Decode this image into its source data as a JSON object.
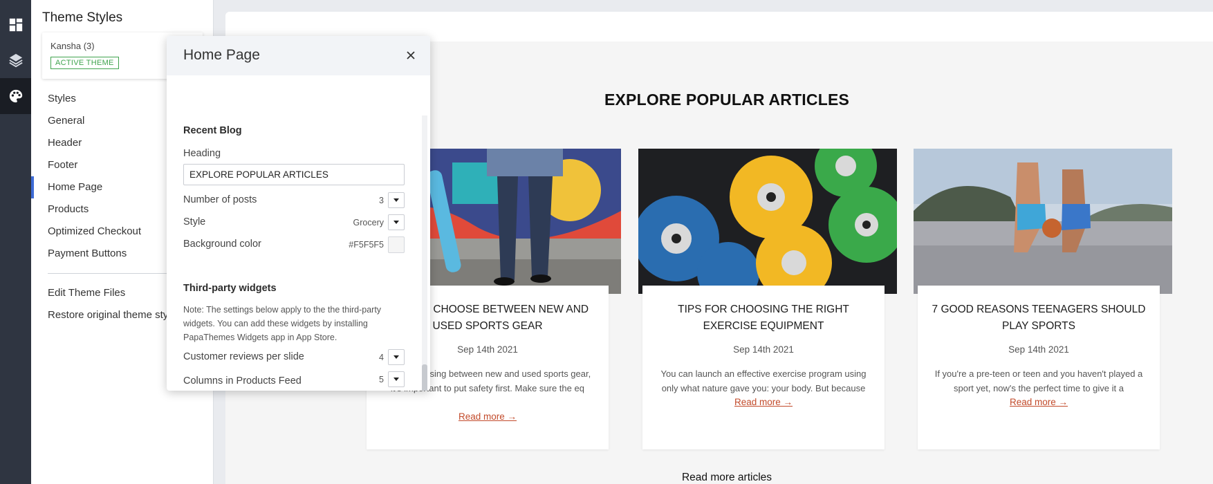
{
  "rail": {
    "items": [
      {
        "icon": "dashboard-icon"
      },
      {
        "icon": "layers-icon"
      },
      {
        "icon": "palette-icon",
        "active": true
      }
    ]
  },
  "sidebar": {
    "title": "Theme Styles",
    "theme": {
      "name": "Kansha (3)",
      "badge": "ACTIVE THEME"
    },
    "items": [
      {
        "label": "Styles"
      },
      {
        "label": "General"
      },
      {
        "label": "Header"
      },
      {
        "label": "Footer"
      },
      {
        "label": "Home Page",
        "active": true
      },
      {
        "label": "Products"
      },
      {
        "label": "Optimized Checkout"
      },
      {
        "label": "Payment Buttons"
      }
    ],
    "footer_items": [
      {
        "label": "Edit Theme Files"
      },
      {
        "label": "Restore original theme styles"
      }
    ]
  },
  "editor": {
    "title": "Home Page",
    "close_icon": "close-icon",
    "recent_blog": {
      "group_title": "Recent Blog",
      "heading_label": "Heading",
      "heading_value": "EXPLORE POPULAR ARTICLES",
      "posts_label": "Number of posts",
      "posts_value": "3",
      "style_label": "Style",
      "style_value": "Grocery",
      "bg_label": "Background color",
      "bg_value": "#F5F5F5"
    },
    "third_party": {
      "group_title": "Third-party widgets",
      "note": "Note: The settings below apply to the the third-party widgets. You can add these widgets by installing PapaThemes Widgets app in App Store.",
      "reviews_label": "Customer reviews per slide",
      "reviews_value": "4",
      "columns_label": "Columns in Products Feed widget",
      "columns_value": "5"
    }
  },
  "preview": {
    "section_title": "EXPLORE POPULAR ARTICLES",
    "cards": [
      {
        "title": "HOW TO CHOOSE BETWEEN NEW AND USED SPORTS GEAR",
        "date": "Sep 14th 2021",
        "excerpt": "When choosing between new and used sports gear, it's important to put safety first. Make sure the eq",
        "read_more": "Read more →"
      },
      {
        "title": "TIPS FOR CHOOSING THE RIGHT EXERCISE EQUIPMENT",
        "date": "Sep 14th 2021",
        "excerpt": "You can launch an effective exercise program using only what nature gave you: your body. But because",
        "read_more": "Read more →"
      },
      {
        "title": "7 GOOD REASONS TEENAGERS SHOULD PLAY SPORTS",
        "date": "Sep 14th 2021",
        "excerpt": "If you're a pre-teen or teen and you haven't played a sport yet, now's the perfect time to give it a",
        "read_more": "Read more →"
      }
    ],
    "read_more_all": "Read more articles"
  },
  "colors": {
    "rail_bg": "#2f3541",
    "active_accent": "#3d6bd6",
    "badge_green": "#3fa34d",
    "link_red": "#c24a2a",
    "preview_bg": "#F5F5F5"
  }
}
